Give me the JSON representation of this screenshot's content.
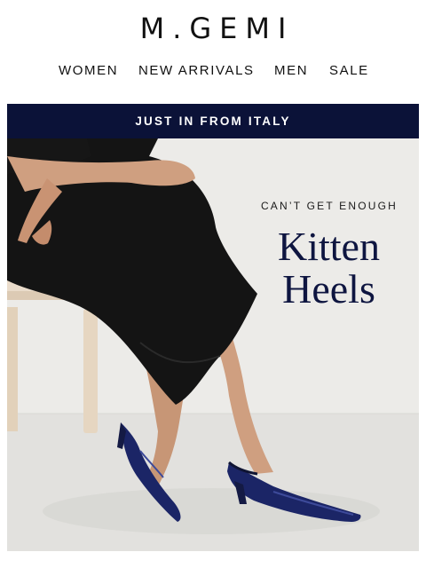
{
  "brand": {
    "logo_text": "M.GEMI"
  },
  "nav": {
    "items": [
      {
        "label": "WOMEN"
      },
      {
        "label": "NEW ARRIVALS"
      },
      {
        "label": "MEN"
      },
      {
        "label": "SALE"
      }
    ]
  },
  "announcement": {
    "text": "JUST IN FROM ITALY"
  },
  "hero": {
    "eyebrow": "CAN’T GET ENOUGH",
    "headline_line1": "Kitten",
    "headline_line2": "Heels",
    "image": "model-in-navy-patent-kitten-heels-photo"
  },
  "colors": {
    "announcement_bg": "#0b1238",
    "headline": "#0e1540",
    "shoe": "#1b2566"
  }
}
